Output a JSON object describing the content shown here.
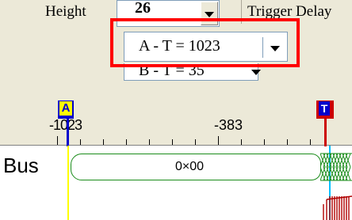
{
  "toolbar": {
    "height_label": "Height",
    "height_value": "26",
    "trigger_delay_label": "Trigger Delay",
    "at_readout": "A - T = 1023",
    "bt_readout": "B - T = 35"
  },
  "ruler": {
    "marker_a": "A",
    "marker_t": "T",
    "label_left": "-1023",
    "label_mid": "-383"
  },
  "waveform": {
    "bus_name": "Bus",
    "bus_value": "0×00"
  },
  "colors": {
    "highlight_box": "#ff0000",
    "marker_a_line": "#ffff00",
    "marker_t_line": "#00c0ff",
    "bus_signal": "#1a8c1a",
    "toolbar_bg": "#ece9d8"
  }
}
